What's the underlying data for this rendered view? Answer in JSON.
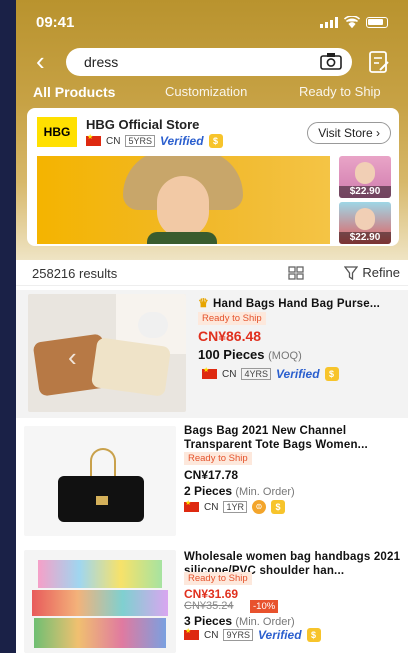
{
  "status": {
    "time": "09:41"
  },
  "search": {
    "query": "dress"
  },
  "tabs": [
    {
      "label": "All Products",
      "active": true
    },
    {
      "label": "Customization",
      "active": false
    },
    {
      "label": "Ready to Ship",
      "active": false
    }
  ],
  "store": {
    "logo_text": "HBG",
    "name": "HBG Official Store",
    "country": "CN",
    "years": "5YRS",
    "verified": "Verified",
    "visit_label": "Visit Store ›",
    "thumbs": [
      {
        "price": "$22.90"
      },
      {
        "price": "$22.90"
      }
    ]
  },
  "results": {
    "count": "258216 results",
    "refine_label": "Refine"
  },
  "products": [
    {
      "title": "Hand Bags Hand Bag Purse...",
      "tag": "Ready to Ship",
      "price": "CN¥86.48",
      "moq": "100 Pieces",
      "moq_note": "(MOQ)",
      "country": "CN",
      "years": "4YRS",
      "verified": "Verified"
    },
    {
      "title": "Bags Bag 2021 New Channel Transparent Tote Bags Women...",
      "tag": "Ready to Ship",
      "price": "CN¥17.78",
      "moq": "2 Pieces",
      "moq_note": "(Min. Order)",
      "country": "CN",
      "years": "1YR"
    },
    {
      "title": "Wholesale women bag handbags 2021 silicone/PVC shoulder han...",
      "tag": "Ready to Ship",
      "price": "CN¥31.69",
      "old_price": "CN¥35.24",
      "discount": "-10%",
      "moq": "3 Pieces",
      "moq_note": "(Min. Order)",
      "country": "CN",
      "years": "9YRS",
      "verified": "Verified"
    }
  ],
  "colors": {
    "accent": "#e0301e",
    "verified": "#2b5fce",
    "hero": "#c7a245"
  }
}
